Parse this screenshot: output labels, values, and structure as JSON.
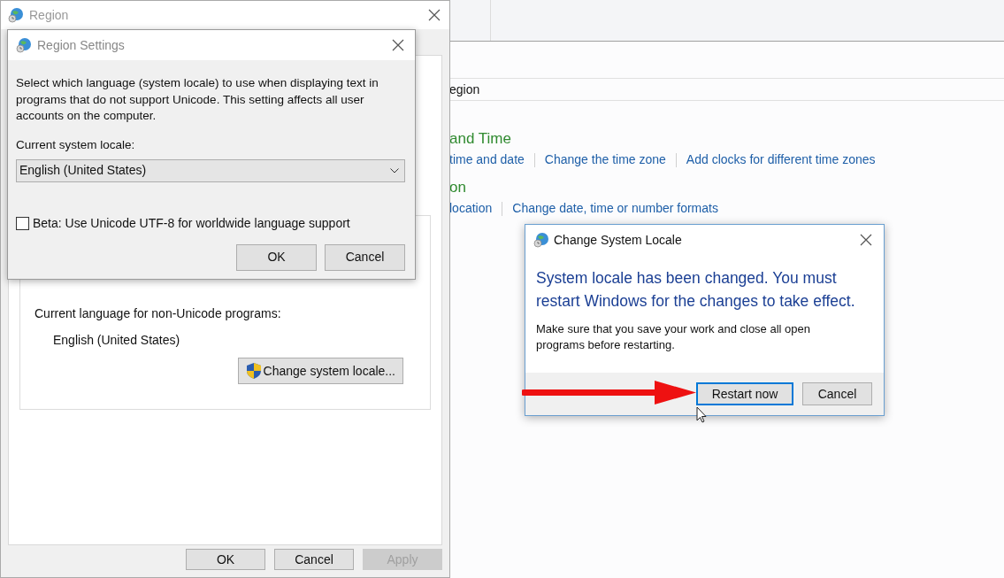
{
  "control_panel": {
    "breadcrumb": "egion",
    "sections": [
      {
        "heading": "and Time",
        "links": [
          "time and date",
          "Change the time zone",
          "Add clocks for different time zones"
        ]
      },
      {
        "heading": "on",
        "links": [
          "location",
          "Change date, time or number formats"
        ]
      }
    ]
  },
  "region_window": {
    "title": "Region",
    "group": {
      "label": "Current language for non-Unicode programs:",
      "value": "English (United States)",
      "button": "Change system locale..."
    },
    "buttons": [
      {
        "label": "OK",
        "disabled": false
      },
      {
        "label": "Cancel",
        "disabled": false
      },
      {
        "label": "Apply",
        "disabled": true
      }
    ]
  },
  "region_settings": {
    "title": "Region Settings",
    "description": "Select which language (system locale) to use when displaying text in programs that do not support Unicode. This setting affects all user accounts on the computer.",
    "locale_label": "Current system locale:",
    "locale_value": "English (United States)",
    "beta": {
      "label": "Beta: Use Unicode UTF-8 for worldwide language support",
      "checked": false
    },
    "buttons": [
      {
        "label": "OK",
        "selected": false
      },
      {
        "label": "Cancel",
        "selected": false
      }
    ]
  },
  "change_locale_dialog": {
    "title": "Change System Locale",
    "headline": "System locale has been changed. You must restart Windows for the changes to take effect.",
    "message": "Make sure that you save your work and close all open programs before restarting.",
    "buttons": [
      {
        "label": "Restart now",
        "selected": true
      },
      {
        "label": "Cancel",
        "selected": false
      }
    ]
  }
}
